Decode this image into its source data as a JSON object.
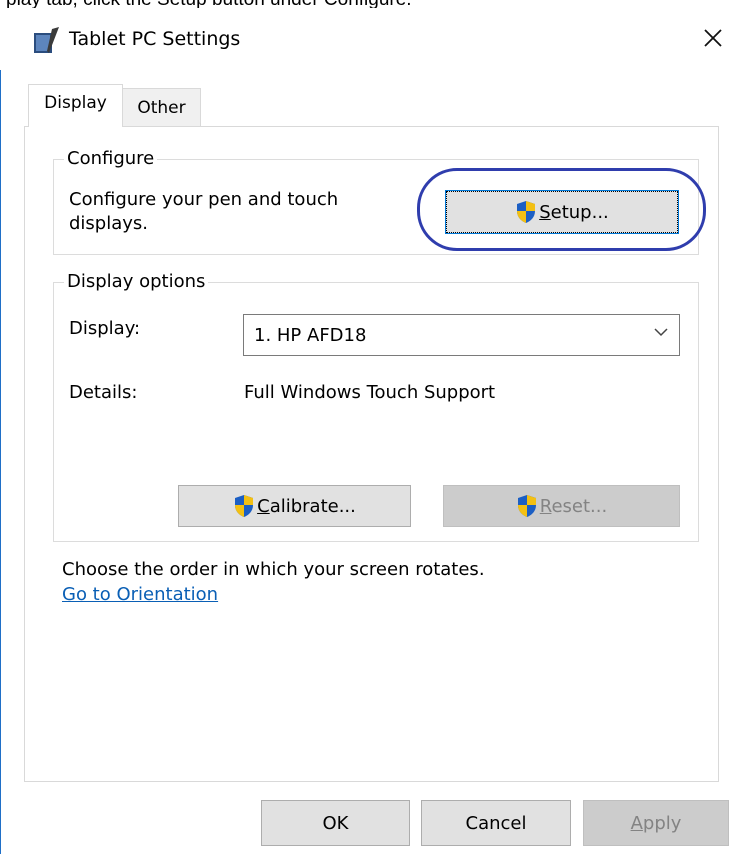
{
  "caption": "play tab, click the Setup button under Configure.",
  "window": {
    "title": "Tablet PC Settings",
    "close_icon": "close-icon"
  },
  "tabs": [
    {
      "label": "Display",
      "active": true
    },
    {
      "label": "Other",
      "active": false
    }
  ],
  "configure": {
    "caption": "Configure",
    "description_line1": "Configure your pen and touch",
    "description_line2": "displays.",
    "setup_button": {
      "mnemonic": "S",
      "rest": "etup..."
    }
  },
  "display_options": {
    "caption": "Display options",
    "display_label": "Display:",
    "display_selected": "1. HP AFD18",
    "details_label": "Details:",
    "details_value": "Full Windows Touch Support",
    "calibrate_button": {
      "mnemonic": "C",
      "rest": "alibrate..."
    },
    "reset_button": {
      "mnemonic": "R",
      "rest": "eset...",
      "disabled": true
    }
  },
  "orientation": {
    "text": "Choose the order in which your screen rotates.",
    "link": "Go to Orientation"
  },
  "footer": {
    "ok": "OK",
    "cancel": "Cancel",
    "apply": {
      "mnemonic": "A",
      "rest": "pply",
      "disabled": true
    }
  },
  "colors": {
    "highlight_ring": "#2f3dad",
    "link": "#0a5fb5",
    "shield_blue": "#1c5fc4",
    "shield_yellow": "#f3c013"
  }
}
